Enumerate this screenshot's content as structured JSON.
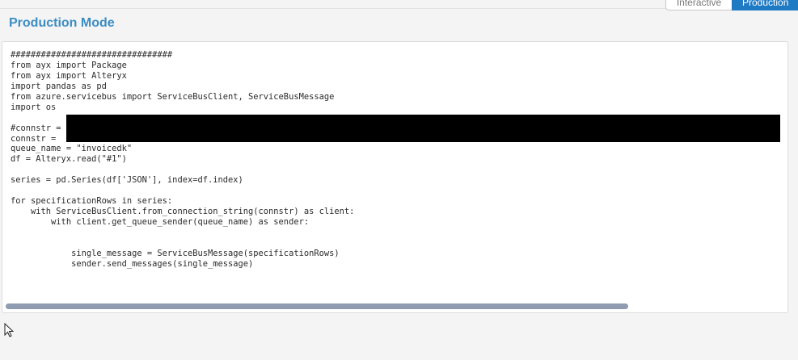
{
  "header": {
    "mode_toggle": [
      {
        "label": "Interactive",
        "active": false
      },
      {
        "label": "Production",
        "active": true
      }
    ],
    "title": "Production Mode"
  },
  "colors": {
    "accent": "#1f7ac4",
    "title": "#3b8dc4",
    "redaction": "#000000",
    "scrollbar": "#8f9bb0"
  },
  "editor": {
    "code_lines": [
      "################################",
      "from ayx import Package",
      "from ayx import Alteryx",
      "import pandas as pd",
      "from azure.servicebus import ServiceBusClient, ServiceBusMessage",
      "import os",
      "",
      "#connstr = ",
      "connstr = ",
      "queue_name = \"invoicedk\"",
      "df = Alteryx.read(\"#1\")",
      "",
      "series = pd.Series(df['JSON'], index=df.index)",
      "",
      "for specificationRows in series:",
      "    with ServiceBusClient.from_connection_string(connstr) as client:",
      "        with client.get_queue_sender(queue_name) as sender:",
      "",
      "",
      "            single_message = ServiceBusMessage(specificationRows)",
      "            sender.send_messages(single_message)"
    ],
    "scrollbar_fraction": 0.8
  },
  "icons": {
    "cursor": "mouse-pointer-icon"
  }
}
